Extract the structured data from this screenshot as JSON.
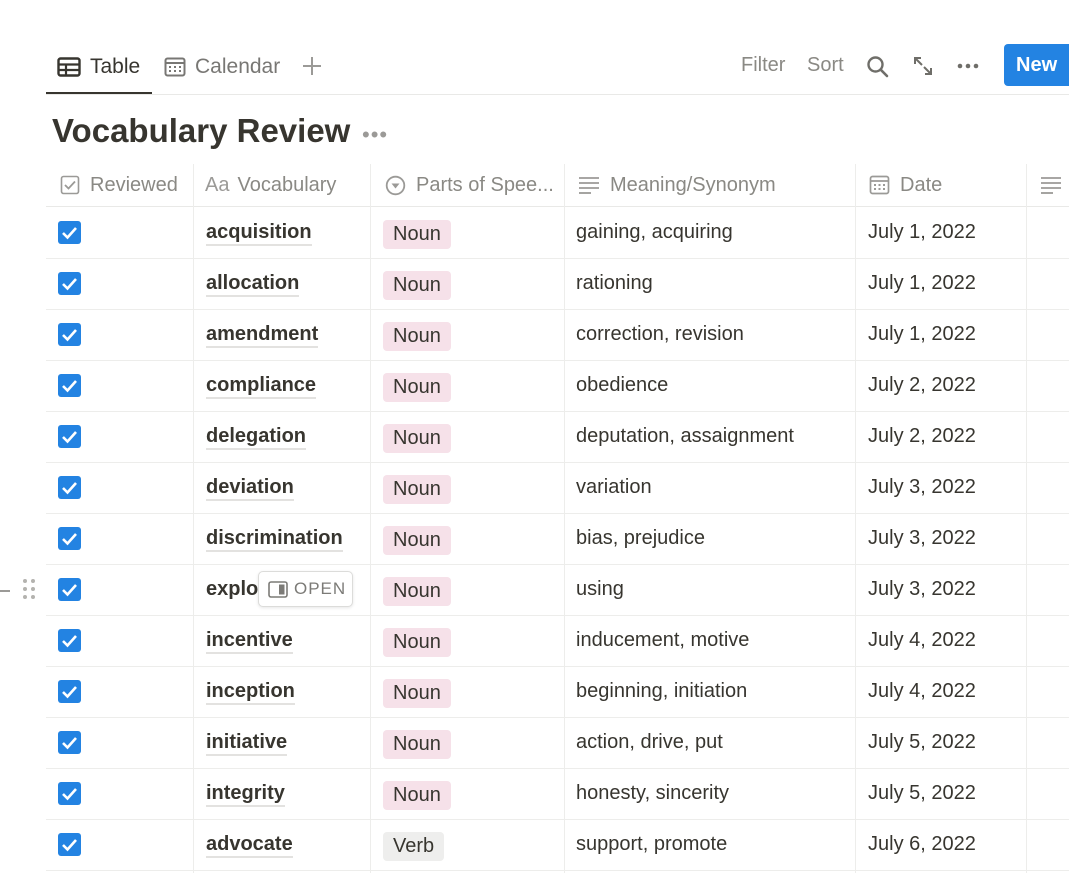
{
  "views": {
    "table_label": "Table",
    "calendar_label": "Calendar"
  },
  "toolbar": {
    "filter_label": "Filter",
    "sort_label": "Sort",
    "new_label": "New"
  },
  "database": {
    "title": "Vocabulary Review"
  },
  "columns": {
    "reviewed": "Reviewed",
    "vocabulary": "Vocabulary",
    "parts_of_speech": "Parts of Spee...",
    "meaning": "Meaning/Synonym",
    "date": "Date"
  },
  "rows": [
    {
      "reviewed": true,
      "word": "acquisition",
      "pos": "Noun",
      "meaning": "gaining, acquiring",
      "date": "July 1, 2022"
    },
    {
      "reviewed": true,
      "word": "allocation",
      "pos": "Noun",
      "meaning": "rationing",
      "date": "July 1, 2022"
    },
    {
      "reviewed": true,
      "word": "amendment",
      "pos": "Noun",
      "meaning": "correction, revision",
      "date": "July 1, 2022"
    },
    {
      "reviewed": true,
      "word": "compliance",
      "pos": "Noun",
      "meaning": "obedience",
      "date": "July 2, 2022"
    },
    {
      "reviewed": true,
      "word": "delegation",
      "pos": "Noun",
      "meaning": "deputation, assaignment",
      "date": "July 2, 2022"
    },
    {
      "reviewed": true,
      "word": "deviation",
      "pos": "Noun",
      "meaning": "variation",
      "date": "July 3, 2022"
    },
    {
      "reviewed": true,
      "word": "discrimination",
      "pos": "Noun",
      "meaning": "bias, prejudice",
      "date": "July 3, 2022"
    },
    {
      "reviewed": true,
      "word": "explo",
      "pos": "Noun",
      "meaning": "using",
      "date": "July 3, 2022"
    },
    {
      "reviewed": true,
      "word": "incentive",
      "pos": "Noun",
      "meaning": "inducement, motive",
      "date": "July 4, 2022"
    },
    {
      "reviewed": true,
      "word": "inception",
      "pos": "Noun",
      "meaning": "beginning, initiation",
      "date": "July 4, 2022"
    },
    {
      "reviewed": true,
      "word": "initiative",
      "pos": "Noun",
      "meaning": "action, drive, put",
      "date": "July 5, 2022"
    },
    {
      "reviewed": true,
      "word": "integrity",
      "pos": "Noun",
      "meaning": "honesty, sincerity",
      "date": "July 5, 2022"
    },
    {
      "reviewed": true,
      "word": "advocate",
      "pos": "Verb",
      "meaning": "support, promote",
      "date": "July 6, 2022"
    }
  ],
  "hover": {
    "open_label": "OPEN"
  },
  "colors": {
    "accent": "#2383e2",
    "noun_tag": "#f6e1e9",
    "verb_tag": "#eeeeed",
    "text": "#37352f"
  },
  "icons": [
    "table-icon",
    "calendar-icon",
    "plus-icon",
    "search-icon",
    "expand-icon",
    "more-icon",
    "checkbox-icon",
    "text-icon",
    "select-icon",
    "lines-icon",
    "date-icon",
    "drag-handle-icon",
    "open-panel-icon"
  ]
}
